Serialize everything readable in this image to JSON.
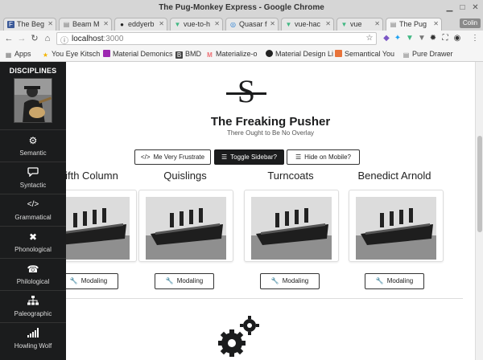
{
  "window": {
    "title": "The Pug-Monkey Express - Google Chrome"
  },
  "tabs": [
    {
      "label": "The Beg",
      "fav": "F",
      "fav_color": "#3b5998"
    },
    {
      "label": "Beam M",
      "fav": "▤",
      "fav_color": "#777777"
    },
    {
      "label": "eddyerb",
      "fav": "●",
      "fav_color": "#222222"
    },
    {
      "label": "vue-to-h",
      "fav": "▼",
      "fav_color": "#41b883"
    },
    {
      "label": "Quasar f",
      "fav": "◎",
      "fav_color": "#1976d2"
    },
    {
      "label": "vue-hac",
      "fav": "▼",
      "fav_color": "#41b883"
    },
    {
      "label": "vue",
      "fav": "▼",
      "fav_color": "#41b883"
    },
    {
      "label": "The Pug",
      "fav": "▤",
      "fav_color": "#777777"
    }
  ],
  "user_badge": "Colin",
  "address": {
    "host": "localhost",
    "port": ":3000"
  },
  "bookmarks": [
    {
      "label": "Apps",
      "icon": "apps-grid",
      "color": "#777777"
    },
    {
      "label": "You Eye Kitsch",
      "icon": "star",
      "color": "#f4b400"
    },
    {
      "label": "Material Demonics",
      "icon": "square",
      "color": "#9c27b0"
    },
    {
      "label": "BMD",
      "icon": "B",
      "color": "#444444"
    },
    {
      "label": "Materialize-o",
      "icon": "M",
      "color": "#ee6e73"
    },
    {
      "label": "Material Design Li",
      "icon": "circle",
      "color": "#222222"
    },
    {
      "label": "Semantical You",
      "icon": "square",
      "color": "#e8733a"
    },
    {
      "label": "Pure Drawer",
      "icon": "page",
      "color": "#777777"
    }
  ],
  "sidebar": {
    "heading": "DISCIPLINES",
    "items": [
      {
        "label": "Semantic",
        "icon": "cogs-icon",
        "glyph": "⚙"
      },
      {
        "label": "Syntactic",
        "icon": "comment-icon",
        "glyph": "💬"
      },
      {
        "label": "Grammatical",
        "icon": "code-icon",
        "glyph": "</>"
      },
      {
        "label": "Phonological",
        "icon": "close-icon",
        "glyph": "✖"
      },
      {
        "label": "Philological",
        "icon": "phone-icon",
        "glyph": "☎"
      },
      {
        "label": "Paleographic",
        "icon": "sitemap-icon",
        "glyph": "⛬"
      },
      {
        "label": "Howling Wolf",
        "icon": "signal-icon",
        "glyph": "▁▃▅▇"
      }
    ]
  },
  "site": {
    "logo_letter": "S",
    "title": "The Freaking Pusher",
    "subtitle": "There Ought to Be No Overlay"
  },
  "buttons": [
    {
      "label": "Me Very Frustrate",
      "icon": "</>"
    },
    {
      "label": "Toggle Sidebar?",
      "icon": "☰"
    },
    {
      "label": "Hide on Mobile?",
      "icon": "☰"
    }
  ],
  "columns": [
    {
      "title": "Fifth Column",
      "button": "Modaling"
    },
    {
      "title": "Quislings",
      "button": "Modaling"
    },
    {
      "title": "Turncoats",
      "button": "Modaling"
    },
    {
      "title": "Benedict Arnold",
      "button": "Modaling"
    }
  ],
  "colors": {
    "sidebar_bg": "#1b1c1d",
    "accent_dark": "#1b1c1d"
  }
}
